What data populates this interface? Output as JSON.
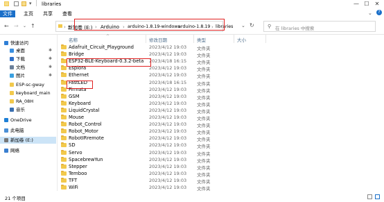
{
  "window": {
    "title": "libraries"
  },
  "ribbon": {
    "tabs": [
      "文件",
      "主页",
      "共享",
      "查看"
    ]
  },
  "address": {
    "crumbs": [
      "新加卷 (E:)",
      "Arduino",
      "arduino-1.8.19-windows",
      "arduino-1.8.19",
      "libraries"
    ],
    "search_placeholder": "在 libraries 中搜索"
  },
  "sidebar": {
    "items": [
      {
        "label": "快速访问",
        "icon": "star-icon",
        "color": "#2f7fd6"
      },
      {
        "label": "桌面",
        "icon": "desktop-icon",
        "color": "#3a8fe0"
      },
      {
        "label": "下载",
        "icon": "download-icon",
        "color": "#2f6fc8"
      },
      {
        "label": "文档",
        "icon": "documents-icon",
        "color": "#6a7f99"
      },
      {
        "label": "图片",
        "icon": "pictures-icon",
        "color": "#3aa0e0"
      },
      {
        "label": "ESP-sc-gway",
        "icon": "folder-icon",
        "color": "#f2c94c"
      },
      {
        "label": "keyboard_main",
        "icon": "folder-icon",
        "color": "#f2c94c"
      },
      {
        "label": "RA_08H",
        "icon": "folder-icon",
        "color": "#f2c94c"
      },
      {
        "label": "音乐",
        "icon": "music-icon",
        "color": "#3a6fb0"
      },
      {
        "label": "OneDrive",
        "icon": "cloud-icon",
        "color": "#1e7fd6"
      },
      {
        "label": "此电脑",
        "icon": "computer-icon",
        "color": "#4a8fd6"
      },
      {
        "label": "新加卷 (E:)",
        "icon": "drive-icon",
        "color": "#777777"
      },
      {
        "label": "网络",
        "icon": "network-icon",
        "color": "#3a7fd0"
      }
    ]
  },
  "columns": {
    "name": "名称",
    "date": "修改日期",
    "type": "类型",
    "size": "大小"
  },
  "files": [
    {
      "name": "Adafruit_Circuit_Playground",
      "date": "2023/4/12 19:03",
      "type": "文件夹"
    },
    {
      "name": "Bridge",
      "date": "2023/4/12 19:03",
      "type": "文件夹"
    },
    {
      "name": "ESP32-BLE-Keyboard-0.3.2-beta",
      "date": "2023/4/18 16:15",
      "type": "文件夹"
    },
    {
      "name": "Esplora",
      "date": "2023/4/12 19:03",
      "type": "文件夹"
    },
    {
      "name": "Ethernet",
      "date": "2023/4/12 19:03",
      "type": "文件夹"
    },
    {
      "name": "FastLED",
      "date": "2023/4/18 16:15",
      "type": "文件夹"
    },
    {
      "name": "Firmata",
      "date": "2023/4/12 19:03",
      "type": "文件夹"
    },
    {
      "name": "GSM",
      "date": "2023/4/12 19:03",
      "type": "文件夹"
    },
    {
      "name": "Keyboard",
      "date": "2023/4/12 19:03",
      "type": "文件夹"
    },
    {
      "name": "LiquidCrystal",
      "date": "2023/4/12 19:03",
      "type": "文件夹"
    },
    {
      "name": "Mouse",
      "date": "2023/4/12 19:03",
      "type": "文件夹"
    },
    {
      "name": "Robot_Control",
      "date": "2023/4/12 19:03",
      "type": "文件夹"
    },
    {
      "name": "Robot_Motor",
      "date": "2023/4/12 19:03",
      "type": "文件夹"
    },
    {
      "name": "RobotIRremote",
      "date": "2023/4/12 19:03",
      "type": "文件夹"
    },
    {
      "name": "SD",
      "date": "2023/4/12 19:03",
      "type": "文件夹"
    },
    {
      "name": "Servo",
      "date": "2023/4/12 19:03",
      "type": "文件夹"
    },
    {
      "name": "SpacebrewYun",
      "date": "2023/4/12 19:03",
      "type": "文件夹"
    },
    {
      "name": "Stepper",
      "date": "2023/4/12 19:03",
      "type": "文件夹"
    },
    {
      "name": "Temboo",
      "date": "2023/4/12 19:03",
      "type": "文件夹"
    },
    {
      "name": "TFT",
      "date": "2023/4/12 19:03",
      "type": "文件夹"
    },
    {
      "name": "WiFi",
      "date": "2023/4/12 19:03",
      "type": "文件夹"
    }
  ],
  "status": {
    "count": "21 个项目"
  },
  "colors": {
    "accent": "#1a6fc9",
    "highlight": "#e02020",
    "folder": "#f2c94c"
  }
}
